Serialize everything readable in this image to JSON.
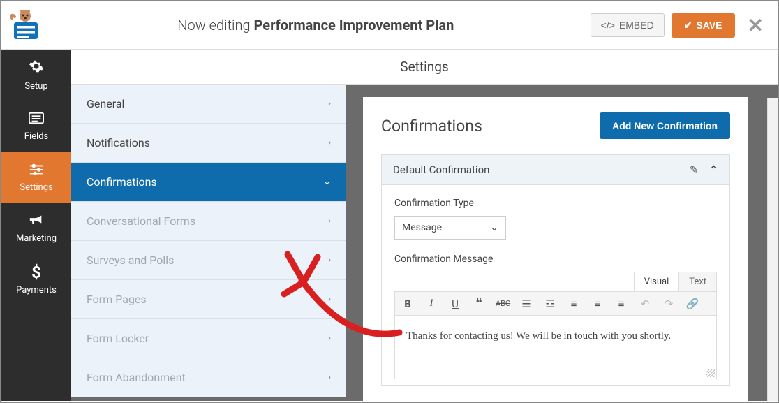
{
  "header": {
    "editing_prefix": "Now editing",
    "form_name": "Performance Improvement Plan",
    "embed_label": "EMBED",
    "save_label": "SAVE"
  },
  "sidebar": {
    "items": [
      {
        "label": "Setup",
        "icon": "gear"
      },
      {
        "label": "Fields",
        "icon": "list"
      },
      {
        "label": "Settings",
        "icon": "sliders"
      },
      {
        "label": "Marketing",
        "icon": "bullhorn"
      },
      {
        "label": "Payments",
        "icon": "dollar"
      }
    ],
    "active_index": 2
  },
  "settings_menu": {
    "title": "Settings",
    "items": [
      {
        "label": "General",
        "state": "normal"
      },
      {
        "label": "Notifications",
        "state": "normal"
      },
      {
        "label": "Confirmations",
        "state": "active"
      },
      {
        "label": "Conversational Forms",
        "state": "dim"
      },
      {
        "label": "Surveys and Polls",
        "state": "dim"
      },
      {
        "label": "Form Pages",
        "state": "dim"
      },
      {
        "label": "Form Locker",
        "state": "dim"
      },
      {
        "label": "Form Abandonment",
        "state": "dim"
      }
    ]
  },
  "panel": {
    "title": "Confirmations",
    "add_button": "Add New Confirmation",
    "card_title": "Default Confirmation",
    "type_label": "Confirmation Type",
    "type_value": "Message",
    "message_label": "Confirmation Message",
    "tabs": {
      "visual": "Visual",
      "text": "Text",
      "active": "visual"
    },
    "message_body": "Thanks for contacting us! We will be in touch with you shortly."
  },
  "icons": {
    "gear": "⚙",
    "list": "▤",
    "sliders": "⚙",
    "bullhorn": "📢",
    "dollar": "$",
    "check": "✔",
    "code": "</>",
    "chevron_right": "›",
    "chevron_down": "⌄",
    "pencil": "✎",
    "caret_up": "⌃"
  },
  "colors": {
    "accent": "#e27730",
    "primary": "#0e6cad"
  }
}
